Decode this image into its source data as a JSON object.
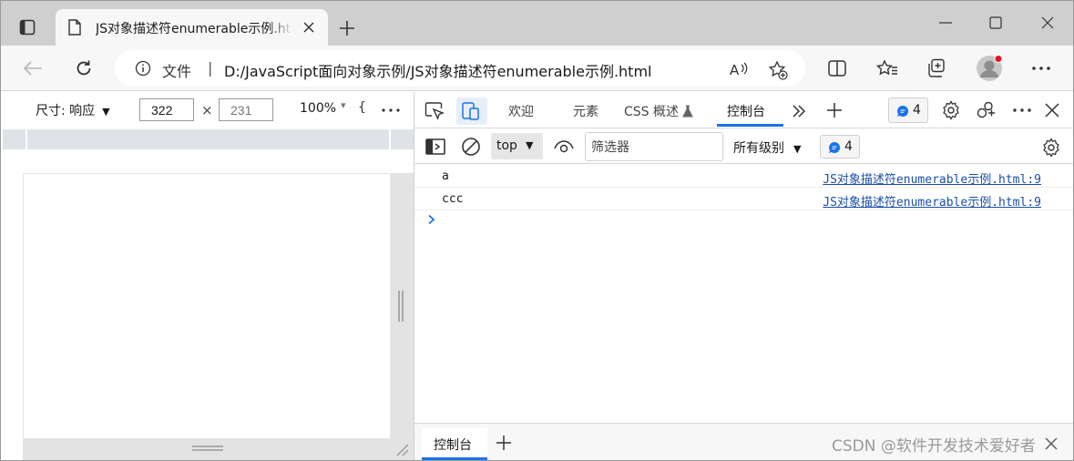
{
  "browser": {
    "tab_title": "JS对象描述符enumerable示例.html",
    "address": {
      "scheme_label": "文件",
      "separator": "|",
      "url": "D:/JavaScript面向对象示例/JS对象描述符enumerable示例.html"
    },
    "icons": [
      "tab-actions-icon",
      "page-icon",
      "close-icon",
      "plus-icon",
      "minimize-icon",
      "maximize-icon",
      "back-arrow-icon",
      "refresh-icon",
      "info-icon",
      "read-aloud-icon",
      "favorite-add-icon",
      "split-screen-icon",
      "favorites-icon",
      "collections-icon",
      "profile-avatar-icon",
      "more-icon"
    ]
  },
  "device_toolbar": {
    "dimensions_label": "尺寸: 响应",
    "width_value": "322",
    "times": "×",
    "height_placeholder": "231",
    "zoom": "100%",
    "zoom_caret": "▾",
    "throttle_glyph": "{"
  },
  "devtools": {
    "tabs": [
      {
        "label": "欢迎"
      },
      {
        "label": "元素"
      },
      {
        "label": "CSS 概述"
      },
      {
        "label": "控制台",
        "active": true
      }
    ],
    "issues_count": "4",
    "accent_color": "#1a73e8",
    "console": {
      "context": "top",
      "filter_placeholder": "筛选器",
      "levels_label": "所有级别",
      "issues_count": "4",
      "logs": [
        {
          "message": "a",
          "source": "JS对象描述符enumerable示例.html:9"
        },
        {
          "message": "ccc",
          "source": "JS对象描述符enumerable示例.html:9"
        }
      ]
    },
    "drawer": {
      "active_tab": "控制台"
    }
  },
  "watermark": "CSDN @软件开发技术爱好者"
}
